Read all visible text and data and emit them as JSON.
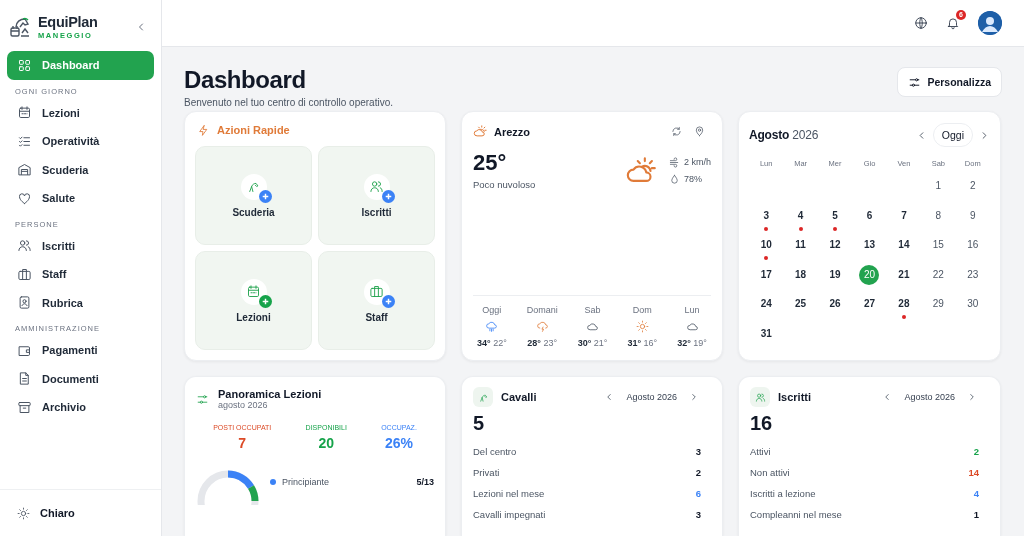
{
  "sidebar": {
    "brand": "EquiPlan",
    "subtitle": "MANEGGIO",
    "items": [
      {
        "kind": "item",
        "label": "Dashboard",
        "selected": true
      },
      {
        "kind": "section",
        "label": "OGNI GIORNO"
      },
      {
        "kind": "item",
        "label": "Lezioni",
        "selected": false
      },
      {
        "kind": "item",
        "label": "Operatività",
        "selected": false
      },
      {
        "kind": "item",
        "label": "Scuderia",
        "selected": false
      },
      {
        "kind": "item",
        "label": "Salute",
        "selected": false
      },
      {
        "kind": "section",
        "label": "PERSONE"
      },
      {
        "kind": "item",
        "label": "Iscritti",
        "selected": false
      },
      {
        "kind": "item",
        "label": "Staff",
        "selected": false
      },
      {
        "kind": "item",
        "label": "Rubrica",
        "selected": false
      },
      {
        "kind": "section",
        "label": "AMMINISTRAZIONE"
      },
      {
        "kind": "item",
        "label": "Pagamenti",
        "selected": false
      },
      {
        "kind": "item",
        "label": "Documenti",
        "selected": false
      },
      {
        "kind": "item",
        "label": "Archivio",
        "selected": false
      }
    ],
    "theme_label": "Chiaro"
  },
  "topbar": {
    "notification_count": "6"
  },
  "header": {
    "title": "Dashboard",
    "subtitle": "Benvenuto nel tuo centro di controllo operativo.",
    "button": "Personalizza"
  },
  "quick_actions": {
    "title": "Azioni Rapide",
    "actions": [
      {
        "label": "Scuderia",
        "color": "#3b82f6"
      },
      {
        "label": "Iscritti",
        "color": "#3b82f6"
      },
      {
        "label": "Lezioni",
        "color": "#16a34a"
      },
      {
        "label": "Staff",
        "color": "#3b82f6"
      }
    ]
  },
  "weather": {
    "city": "Arezzo",
    "temperature": "25°",
    "condition": "Poco nuvoloso",
    "wind": "2 km/h",
    "humidity": "78%",
    "forecast": [
      {
        "day": "Oggi",
        "kind": "rain",
        "high": "34°",
        "low": "22°"
      },
      {
        "day": "Domani",
        "kind": "storm",
        "high": "28°",
        "low": "23°"
      },
      {
        "day": "Sab",
        "kind": "cloud",
        "high": "30°",
        "low": "21°"
      },
      {
        "day": "Dom",
        "kind": "sun",
        "high": "31°",
        "low": "16°"
      },
      {
        "day": "Lun",
        "kind": "cloud",
        "high": "32°",
        "low": "19°"
      }
    ]
  },
  "calendar": {
    "month": "Agosto",
    "year": "2026",
    "today_button": "Oggi",
    "weekdays": [
      "Lun",
      "Mar",
      "Mer",
      "Gio",
      "Ven",
      "Sab",
      "Dom"
    ],
    "weeks": [
      {
        "align_end": true,
        "days": [
          {
            "day": "1",
            "event": false,
            "selected": false
          },
          {
            "day": "2",
            "event": false,
            "selected": false
          }
        ]
      },
      {
        "align_end": false,
        "days": [
          {
            "day": "3",
            "event": true,
            "selected": false
          },
          {
            "day": "4",
            "event": true,
            "selected": false
          },
          {
            "day": "5",
            "event": true,
            "selected": false
          },
          {
            "day": "6",
            "event": false,
            "selected": false
          },
          {
            "day": "7",
            "event": false,
            "selected": false
          },
          {
            "day": "8",
            "event": false,
            "selected": false
          },
          {
            "day": "9",
            "event": false,
            "selected": false
          }
        ]
      },
      {
        "align_end": false,
        "days": [
          {
            "day": "10",
            "event": true,
            "selected": false
          },
          {
            "day": "11",
            "event": false,
            "selected": false
          },
          {
            "day": "12",
            "event": false,
            "selected": false
          },
          {
            "day": "13",
            "event": false,
            "selected": false
          },
          {
            "day": "14",
            "event": false,
            "selected": false
          },
          {
            "day": "15",
            "event": false,
            "selected": false
          },
          {
            "day": "16",
            "event": false,
            "selected": false
          }
        ]
      },
      {
        "align_end": false,
        "days": [
          {
            "day": "17",
            "event": false,
            "selected": false
          },
          {
            "day": "18",
            "event": false,
            "selected": false
          },
          {
            "day": "19",
            "event": false,
            "selected": false
          },
          {
            "day": "20",
            "event": false,
            "selected": true
          },
          {
            "day": "21",
            "event": false,
            "selected": false
          },
          {
            "day": "22",
            "event": false,
            "selected": false
          },
          {
            "day": "23",
            "event": false,
            "selected": false
          }
        ]
      },
      {
        "align_end": false,
        "days": [
          {
            "day": "24",
            "event": false,
            "selected": false
          },
          {
            "day": "25",
            "event": false,
            "selected": false
          },
          {
            "day": "26",
            "event": false,
            "selected": false
          },
          {
            "day": "27",
            "event": false,
            "selected": false
          },
          {
            "day": "28",
            "event": true,
            "selected": false
          },
          {
            "day": "29",
            "event": false,
            "selected": false
          },
          {
            "day": "30",
            "event": false,
            "selected": false
          }
        ]
      },
      {
        "align_end": false,
        "days": [
          {
            "day": "31",
            "event": false,
            "selected": false
          }
        ]
      }
    ]
  },
  "lessons": {
    "title": "Panoramica Lezioni",
    "period": "agosto 2026",
    "stats": [
      {
        "label": "POSTI OCCUPATI",
        "value": "7",
        "color": "#dc4a26"
      },
      {
        "label": "DISPONIBILI",
        "value": "20",
        "color": "#16a34a"
      },
      {
        "label": "OCCUPAZ.",
        "value": "26%",
        "color": "#3b82f6"
      }
    ],
    "legend": [
      {
        "label": "Principiante",
        "value": "5/13",
        "color": "#3b82f6"
      }
    ]
  },
  "summaries": [
    {
      "title": "Cavalli",
      "period": "Agosto 2026",
      "total": "5",
      "rows": [
        {
          "label": "Del centro",
          "value": "3",
          "color": "#111827"
        },
        {
          "label": "Privati",
          "value": "2",
          "color": "#111827"
        },
        {
          "label": "Lezioni nel mese",
          "value": "6",
          "color": "#3b82f6"
        },
        {
          "label": "Cavalli impegnati",
          "value": "3",
          "color": "#111827"
        }
      ]
    },
    {
      "title": "Iscritti",
      "period": "Agosto 2026",
      "total": "16",
      "rows": [
        {
          "label": "Attivi",
          "value": "2",
          "color": "#16a34a"
        },
        {
          "label": "Non attivi",
          "value": "14",
          "color": "#dc4a26"
        },
        {
          "label": "Iscritti a lezione",
          "value": "4",
          "color": "#3b82f6"
        },
        {
          "label": "Compleanni nel mese",
          "value": "1",
          "color": "#111827"
        }
      ]
    }
  ]
}
